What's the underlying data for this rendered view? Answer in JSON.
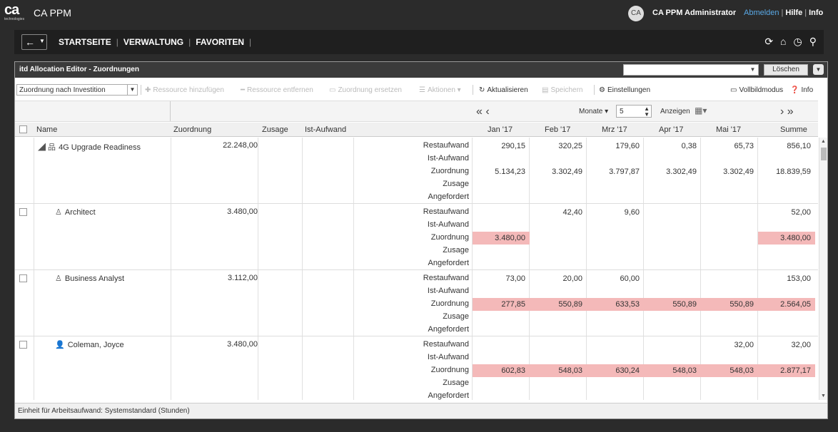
{
  "app": {
    "logo_text": "ca",
    "logo_sub": "technologies",
    "title": "CA PPM"
  },
  "user": {
    "avatar": "CA",
    "name": "CA PPM Administrator",
    "logout": "Abmelden",
    "help": "Hilfe",
    "info": "Info"
  },
  "nav": {
    "back": "←",
    "items": [
      "STARTSEITE",
      "VERWALTUNG",
      "FAVORITEN"
    ]
  },
  "portlet": {
    "title": "itd Allocation Editor - Zuordnungen",
    "delete_label": "Löschen"
  },
  "toolbar": {
    "view_select": "Zuordnung nach Investition",
    "add_resource": "Ressource hinzufügen",
    "remove_resource": "Ressource entfernen",
    "replace_allocation": "Zuordnung ersetzen",
    "actions": "Aktionen",
    "refresh": "Aktualisieren",
    "save": "Speichern",
    "settings": "Einstellungen",
    "fullscreen": "Vollbildmodus",
    "info": "Info"
  },
  "timescale": {
    "unit": "Monate",
    "count": "5",
    "show_label": "Anzeigen"
  },
  "columns": {
    "name": "Name",
    "allocation": "Zuordnung",
    "commitment": "Zusage",
    "actual": "Ist-Aufwand",
    "months": [
      "Jan '17",
      "Feb '17",
      "Mrz '17",
      "Apr '17",
      "Mai '17"
    ],
    "total": "Summe"
  },
  "metrics": [
    "Restaufwand",
    "Ist-Aufwand",
    "Zuordnung",
    "Zusage",
    "Angefordert"
  ],
  "rows": [
    {
      "name": "4G Upgrade Readiness",
      "icon": "project-icon",
      "allocation": "22.248,00",
      "rest": [
        "290,15",
        "320,25",
        "179,60",
        "0,38",
        "65,73",
        "856,10"
      ],
      "alloc": [
        "5.134,23",
        "3.302,49",
        "3.797,87",
        "3.302,49",
        "3.302,49",
        "18.839,59"
      ],
      "alloc_highlight": [
        false,
        false,
        false,
        false,
        false,
        false
      ]
    },
    {
      "name": "Architect",
      "icon": "role-icon",
      "allocation": "3.480,00",
      "rest": [
        "",
        "42,40",
        "9,60",
        "",
        "",
        "52,00"
      ],
      "alloc": [
        "3.480,00",
        "",
        "",
        "",
        "",
        "3.480,00"
      ],
      "alloc_highlight": [
        true,
        false,
        false,
        false,
        false,
        true
      ]
    },
    {
      "name": "Business Analyst",
      "icon": "role-icon",
      "allocation": "3.112,00",
      "rest": [
        "73,00",
        "20,00",
        "60,00",
        "",
        "",
        "153,00"
      ],
      "alloc": [
        "277,85",
        "550,89",
        "633,53",
        "550,89",
        "550,89",
        "2.564,05"
      ],
      "alloc_highlight": [
        true,
        true,
        true,
        true,
        true,
        true
      ]
    },
    {
      "name": "Coleman, Joyce",
      "icon": "person-icon",
      "allocation": "3.480,00",
      "rest": [
        "",
        "",
        "",
        "",
        "32,00",
        "32,00"
      ],
      "alloc": [
        "602,83",
        "548,03",
        "630,24",
        "548,03",
        "548,03",
        "2.877,17"
      ],
      "alloc_highlight": [
        true,
        true,
        true,
        true,
        true,
        true
      ]
    }
  ],
  "footer": "Einheit für Arbeitsaufwand: Systemstandard (Stunden)",
  "colors": {
    "highlight": "#f4b9b9",
    "link": "#5aa9e6",
    "topbar": "#2b2b2b"
  }
}
